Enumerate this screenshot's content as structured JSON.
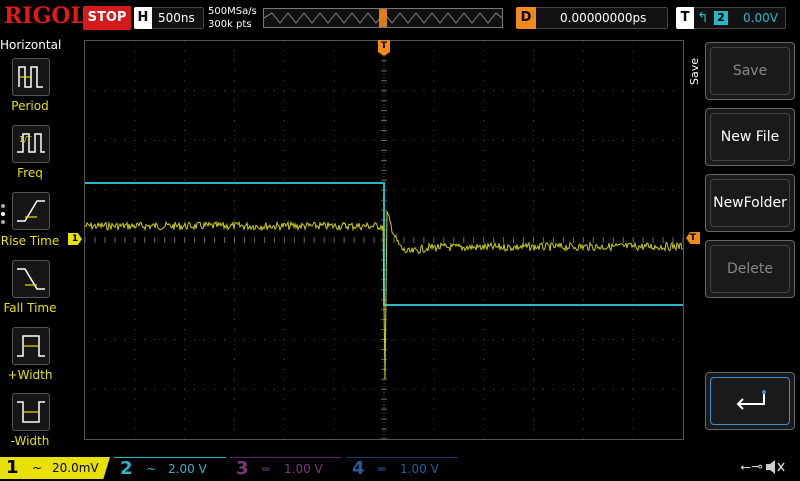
{
  "toolbar": {
    "brand": "RIGOL",
    "run_state": "STOP",
    "timebase_badge": "H",
    "timebase": "500ns",
    "sample_rate": "500MSa/s",
    "memory_depth": "300k pts",
    "delay_badge": "D",
    "delay": "0.00000000ps",
    "trigger_badge": "T",
    "trigger_edge": "↰",
    "trigger_source": "2",
    "trigger_level": "0.00V"
  },
  "left_panel": {
    "title": "Horizontal",
    "items": [
      {
        "label": "Period"
      },
      {
        "label": "Freq"
      },
      {
        "label": "Rise Time"
      },
      {
        "label": "Fall Time"
      },
      {
        "label": "+Width"
      },
      {
        "label": "-Width"
      }
    ]
  },
  "markers": {
    "ch1": "1",
    "trigger_level": "T",
    "trigger_position": "T"
  },
  "right_menu": {
    "title": "Save",
    "buttons": [
      {
        "label": "Save",
        "enabled": false
      },
      {
        "label": "New File",
        "enabled": true
      },
      {
        "label": "NewFolder",
        "enabled": true
      },
      {
        "label": "Delete",
        "enabled": false
      }
    ],
    "return_icon": "return-arrow-icon"
  },
  "channels": [
    {
      "num": "1",
      "coupling": "~",
      "scale": "20.0mV",
      "color": "#e8e000",
      "active": true
    },
    {
      "num": "2",
      "coupling": "~",
      "scale": "2.00 V",
      "color": "#27b7c9",
      "active": true
    },
    {
      "num": "3",
      "coupling": "═",
      "scale": "1.00 V",
      "color": "#7a3a7a",
      "active": false
    },
    {
      "num": "4",
      "coupling": "═",
      "scale": "1.00 V",
      "color": "#2a5a9a",
      "active": false
    }
  ],
  "status_icons": [
    "usb-icon",
    "speaker-mute-icon"
  ],
  "colors": {
    "ch1": "#e8e000",
    "ch2": "#27b7c9",
    "accent": "#f08a1a",
    "stop": "#d41a1a"
  }
}
